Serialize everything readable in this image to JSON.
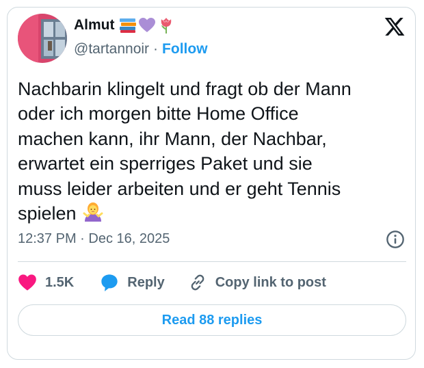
{
  "author": {
    "name": "Almut",
    "handle": "@tartannoir",
    "separator": "·",
    "follow_label": "Follow",
    "name_emojis": [
      "books-emoji",
      "purple-heart-emoji",
      "tulip-emoji"
    ]
  },
  "post": {
    "text": "Nachbarin klingelt und fragt ob der Mann\noder ich morgen bitte Home Office\nmachen kann, ihr Mann, der Nachbar,\nerwartet ein sperriges Paket und sie\nmuss leider arbeiten und er geht Tennis\nspielen",
    "trailing_emoji": "person-shrugging-emoji",
    "timestamp": "12:37 PM · Dec 16, 2025"
  },
  "actions": {
    "like_count": "1.5K",
    "reply_label": "Reply",
    "copy_link_label": "Copy link to post"
  },
  "footer": {
    "read_replies_label": "Read 88 replies"
  },
  "colors": {
    "accent": "#1d9bf0",
    "like": "#f91880",
    "text": "#0f1419",
    "secondary": "#536471",
    "border": "#cfd9de"
  },
  "icons": [
    "x-logo-icon",
    "info-icon",
    "heart-icon",
    "reply-bubble-icon",
    "link-icon"
  ]
}
